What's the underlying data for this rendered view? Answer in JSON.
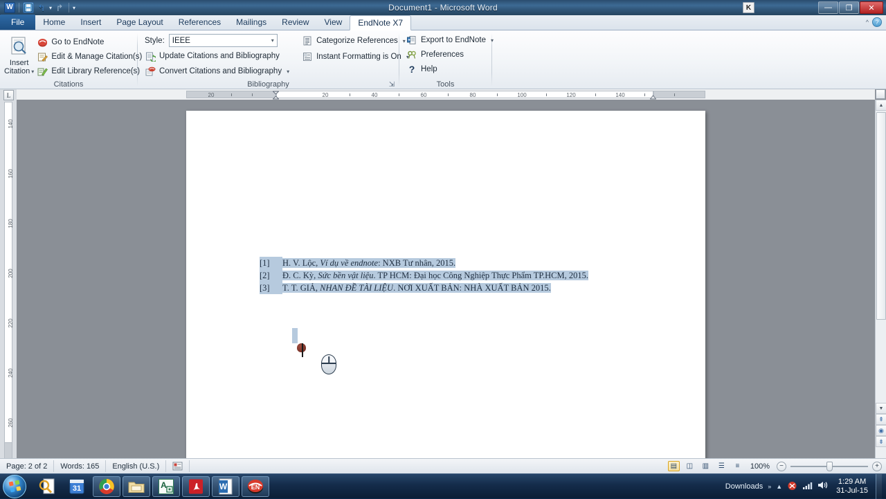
{
  "window": {
    "title": "Document1 - Microsoft Word",
    "k_badge": "K",
    "minimize": "—",
    "restore": "❐",
    "close": "✕"
  },
  "quick_access": {
    "word_icon": "W",
    "save_icon": "save-icon",
    "undo_icon": "↰",
    "redo_icon": "↱",
    "customize_caret": "▾"
  },
  "help": {
    "collapse_caret": "^",
    "help_label": "?"
  },
  "tabs": [
    {
      "label": "File",
      "type": "file"
    },
    {
      "label": "Home",
      "type": "normal"
    },
    {
      "label": "Insert",
      "type": "normal"
    },
    {
      "label": "Page Layout",
      "type": "normal"
    },
    {
      "label": "References",
      "type": "normal"
    },
    {
      "label": "Mailings",
      "type": "normal"
    },
    {
      "label": "Review",
      "type": "normal"
    },
    {
      "label": "View",
      "type": "normal"
    },
    {
      "label": "EndNote X7",
      "type": "active"
    }
  ],
  "ribbon": {
    "citations": {
      "group_label": "Citations",
      "insert_citation": {
        "line1": "Insert",
        "line2": "Citation",
        "caret": "▾"
      },
      "items": [
        {
          "label": "Go to EndNote",
          "icon": "endnote-icon",
          "caret": ""
        },
        {
          "label": "Edit & Manage Citation(s)",
          "icon": "edit-citation-icon",
          "caret": ""
        },
        {
          "label": "Edit Library Reference(s)",
          "icon": "edit-library-icon",
          "caret": ""
        }
      ]
    },
    "bibliography": {
      "group_label": "Bibliography",
      "style_label": "Style:",
      "style_value": "IEEE",
      "style_caret": "▾",
      "items": [
        {
          "label": "Update Citations and Bibliography",
          "icon": "update-bibliography-icon",
          "caret": ""
        },
        {
          "label": "Convert Citations and Bibliography",
          "icon": "convert-bibliography-icon",
          "caret": "▾"
        }
      ],
      "side_items": [
        {
          "label": "Categorize References",
          "icon": "categorize-icon",
          "caret": "▾"
        },
        {
          "label": "Instant Formatting is On",
          "icon": "instant-format-icon",
          "caret": "▾"
        }
      ],
      "dialog_launcher": "⇲"
    },
    "tools": {
      "group_label": "Tools",
      "items": [
        {
          "label": "Export to EndNote",
          "icon": "export-endnote-icon",
          "caret": "▾"
        },
        {
          "label": "Preferences",
          "icon": "preferences-icon",
          "caret": ""
        },
        {
          "label": "Help",
          "icon": "help-question-icon",
          "caret": ""
        }
      ]
    }
  },
  "rulers": {
    "tab_stop_label": "L",
    "horizontal_ticks": [
      "20",
      "",
      "20",
      "40",
      "60",
      "80",
      "100",
      "120",
      "140"
    ],
    "vertical_ticks": [
      "140",
      "160",
      "180",
      "200",
      "220",
      "240",
      "260"
    ]
  },
  "document": {
    "bibliography": [
      {
        "number": "[1]",
        "parts": [
          {
            "text": "H. V. Lộc, ",
            "italic": false
          },
          {
            "text": "Ví dụ về endnote",
            "italic": true
          },
          {
            "text": ": NXB Tư nhân, 2015.",
            "italic": false
          }
        ]
      },
      {
        "number": "[2]",
        "parts": [
          {
            "text": "Đ. C. Kỳ, ",
            "italic": false
          },
          {
            "text": "Sức bền vật liệu",
            "italic": true
          },
          {
            "text": ". TP HCM: Đại học Công Nghiệp Thực Phẩm TP.HCM, 2015.",
            "italic": false
          }
        ]
      },
      {
        "number": "[3]",
        "parts": [
          {
            "text": "T. T. GIẢ, ",
            "italic": false
          },
          {
            "text": "NHAN ĐỀ TÀI LIỆU",
            "italic": true
          },
          {
            "text": ". NƠI XUẤT BẢN: NHÀ XUẤT BẢN 2015.",
            "italic": false
          }
        ]
      }
    ]
  },
  "statusbar": {
    "page": "Page: 2 of 2",
    "words": "Words: 165",
    "language": "English (U.S.)",
    "proofing_icon": "proofing-errors-icon",
    "zoom_value": "100%",
    "zoom_out": "−",
    "zoom_in": "+",
    "views": [
      {
        "name": "print-layout-view",
        "glyph": "▤",
        "active": true
      },
      {
        "name": "full-screen-reading-view",
        "glyph": "◫",
        "active": false
      },
      {
        "name": "web-layout-view",
        "glyph": "▥",
        "active": false
      },
      {
        "name": "outline-view",
        "glyph": "☰",
        "active": false
      },
      {
        "name": "draft-view",
        "glyph": "≡",
        "active": false
      }
    ]
  },
  "scrollbar": {
    "up_arrow": "▲",
    "down_arrow": "▼",
    "prev_page": "⇞",
    "select_browse_object": "◉",
    "next_page": "⇟"
  },
  "taskbar": {
    "start_label": "start-orb",
    "items": [
      {
        "name": "taskbar-endnote-search",
        "label": "EndNote Search",
        "pinned": false
      },
      {
        "name": "taskbar-calendar",
        "label": "31",
        "pinned": false
      },
      {
        "name": "taskbar-google-chrome",
        "label": "Chrome",
        "pinned": true
      },
      {
        "name": "taskbar-windows-explorer",
        "label": "Explorer",
        "pinned": true
      },
      {
        "name": "taskbar-abbyy",
        "label": "ABBYY",
        "pinned": true
      },
      {
        "name": "taskbar-adobe-reader",
        "label": "Adobe Reader",
        "pinned": true
      },
      {
        "name": "taskbar-microsoft-word",
        "label": "W",
        "pinned": true
      },
      {
        "name": "taskbar-endnote",
        "label": "EN",
        "pinned": true
      }
    ],
    "downloads_label": "Downloads",
    "overflow_caret": "»",
    "tray_caret": "▲",
    "clock_time": "1:29 AM",
    "clock_date": "31-Jul-15"
  },
  "colors": {
    "accent_blue": "#2f6aa5",
    "title_bar": "#2b4c6e",
    "selection": "#b6cade",
    "taskbar": "#14304e"
  }
}
